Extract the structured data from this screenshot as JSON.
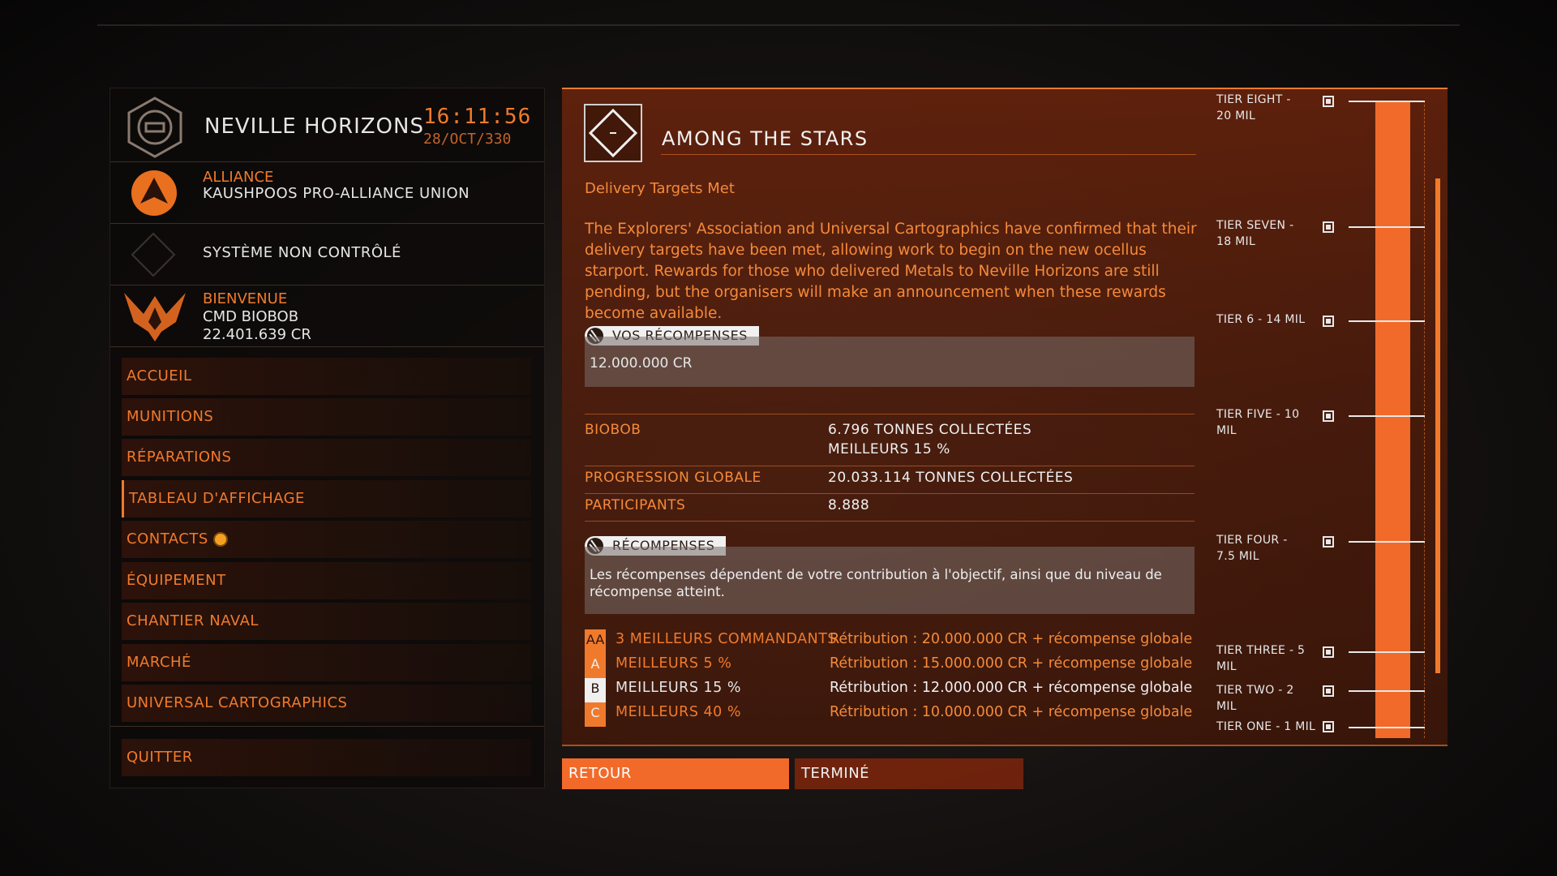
{
  "station": {
    "name": "NEVILLE HORIZONS",
    "time": "16:11:56",
    "date": "28/OCT/330",
    "faction_type": "ALLIANCE",
    "faction_name": "KAUSHPOOS PRO-ALLIANCE UNION",
    "system_status": "SYSTÈME NON CONTRÔLÉ",
    "welcome": "BIENVENUE",
    "commander": "CMD BIOBOB",
    "credits": "22.401.639 CR"
  },
  "menu": [
    {
      "label": "ACCUEIL"
    },
    {
      "label": "MUNITIONS"
    },
    {
      "label": "RÉPARATIONS"
    },
    {
      "label": "TABLEAU D'AFFICHAGE"
    },
    {
      "label": "CONTACTS"
    },
    {
      "label": "ÉQUIPEMENT"
    },
    {
      "label": "CHANTIER NAVAL"
    },
    {
      "label": "MARCHÉ"
    },
    {
      "label": "UNIVERSAL CARTOGRAPHICS"
    },
    {
      "label": "QUITTER"
    }
  ],
  "mission": {
    "title": "AMONG THE STARS",
    "subtitle": "Delivery Targets Met",
    "description": "The Explorers' Association and Universal Cartographics have confirmed that their delivery targets have been met, allowing work to begin on the new ocellus starport. Rewards for those who delivered Metals to Neville Horizons are still pending, but the organisers will make an announcement when these rewards become available.",
    "your_rewards_label": "VOS RÉCOMPENSES",
    "your_rewards_value": "12.000.000 CR",
    "stats": [
      {
        "label": "BIOBOB",
        "value": "6.796 TONNES COLLECTÉES",
        "value2": "MEILLEURS 15 %"
      },
      {
        "label": "PROGRESSION GLOBALE",
        "value": "20.033.114 TONNES COLLECTÉES"
      },
      {
        "label": "PARTICIPANTS",
        "value": "8.888"
      }
    ],
    "rewards_label": "RÉCOMPENSES",
    "rewards_text": "Les récompenses dépendent de votre contribution à l'objectif, ainsi que du niveau de récompense atteint.",
    "ranks": [
      {
        "badge": "AA",
        "label": "3 MEILLEURS COMMANDANTS",
        "reward": "Rétribution : 20.000.000 CR + récompense globale"
      },
      {
        "badge": "A",
        "label": "MEILLEURS 5 %",
        "reward": "Rétribution : 15.000.000 CR + récompense globale"
      },
      {
        "badge": "B",
        "label": "MEILLEURS 15 %",
        "reward": "Rétribution : 12.000.000 CR + récompense globale"
      },
      {
        "badge": "C",
        "label": "MEILLEURS 40 %",
        "reward": "Rétribution : 10.000.000 CR + récompense globale"
      }
    ]
  },
  "tiers": [
    {
      "label": "TIER EIGHT - 20 MIL"
    },
    {
      "label": "TIER SEVEN - 18 MIL"
    },
    {
      "label": "TIER 6 - 14 MIL"
    },
    {
      "label": "TIER FIVE - 10 MIL"
    },
    {
      "label": "TIER FOUR - 7.5 MIL"
    },
    {
      "label": "TIER THREE - 5 MIL"
    },
    {
      "label": "TIER TWO - 2 MIL"
    },
    {
      "label": "TIER ONE - 1 MIL"
    }
  ],
  "progress_fraction": 1.0,
  "buttons": {
    "back": "RETOUR",
    "done": "TERMINÉ"
  },
  "colors": {
    "accent": "#f07a2c",
    "panel": "#73260c",
    "highlight_badge": "#f0f0f0"
  }
}
